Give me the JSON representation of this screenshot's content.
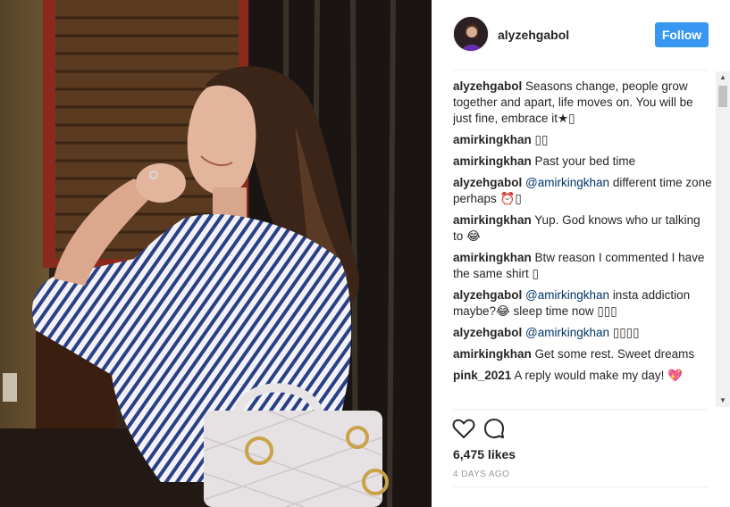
{
  "post": {
    "username": "alyzehgabol",
    "follow_label": "Follow",
    "likes": "6,475 likes",
    "time": "4 DAYS AGO"
  },
  "comments": [
    {
      "author": "alyzehgabol",
      "mention": "",
      "text": "Seasons change, people grow together and apart, life moves on. You will be just fine, embrace it★▯"
    },
    {
      "author": "amirkingkhan",
      "mention": "",
      "text": "▯▯"
    },
    {
      "author": "amirkingkhan",
      "mention": "",
      "text": "Past your bed time"
    },
    {
      "author": "alyzehgabol",
      "mention": "@amirkingkhan",
      "text": "different time zone perhaps ⏰▯"
    },
    {
      "author": "amirkingkhan",
      "mention": "",
      "text": "Yup. God knows who ur talking to 😂"
    },
    {
      "author": "amirkingkhan",
      "mention": "",
      "text": "Btw reason I commented I have the same shirt ▯"
    },
    {
      "author": "alyzehgabol",
      "mention": "@amirkingkhan",
      "text": "insta addiction maybe?😂 sleep time now ▯▯▯"
    },
    {
      "author": "alyzehgabol",
      "mention": "@amirkingkhan",
      "text": "▯▯▯▯"
    },
    {
      "author": "amirkingkhan",
      "mention": "",
      "text": "Get some rest. Sweet dreams"
    },
    {
      "author": "pink_2021",
      "mention": "",
      "text": "A reply would make my day! 💖"
    }
  ],
  "icons": {
    "like": "heart-icon",
    "comment": "speech-bubble-icon",
    "scroll_up": "arrow-up-icon",
    "scroll_down": "arrow-down-icon"
  },
  "colors": {
    "follow_button": "#3897f0",
    "mention": "#003569",
    "text": "#262626",
    "muted": "#999999"
  }
}
